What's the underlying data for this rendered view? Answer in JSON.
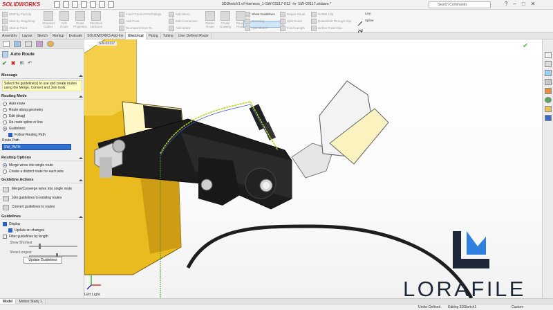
{
  "window": {
    "app_name": "SOLIDWORKS",
    "title": "3DSketch1 of Harness_1-SW-03117-012 -in- SW-03117.sldasm *",
    "search_placeholder": "Search Commands",
    "controls": [
      "?",
      "–",
      "□",
      "✕"
    ]
  },
  "command_manager": {
    "group1": [
      "Start by Pin/Clip",
      "Start by Drag/Drop",
      "Start at Point"
    ],
    "group2": [
      "Standard Cables",
      "Edit Route",
      "Route Properties",
      "Electrical Attributes"
    ],
    "group3": [
      "Insert Connectors/Fittings",
      "Add Point",
      "Re-import From-To"
    ],
    "group4": [
      "Edit Wires",
      "Edit Connection",
      "Add Splice"
    ],
    "group5": [
      "Flatten Route",
      "Create Drawing",
      "Reuse Route"
    ],
    "group6": [
      "Show Guidelines",
      "Covering",
      "Add Sketch"
    ],
    "group7": [
      "Repair Route",
      "Split Route",
      "Fixed Length"
    ],
    "group8": [
      "Rotate Clip",
      "Route/Edit Through Clip",
      "Unfree Fixed Clip"
    ],
    "group9": [
      "Line",
      "Spline"
    ]
  },
  "tabs": [
    "Assembly",
    "Layout",
    "Sketch",
    "Markup",
    "Evaluate",
    "SOLIDWORKS Add-Ins",
    "Electrical",
    "Piping",
    "Tubing",
    "User Defined Route"
  ],
  "active_tab": "Electrical",
  "panel": {
    "title": "Auto Route",
    "message": {
      "header": "Message",
      "text": "Select the guideline(s) to use and create routes using the Merge, Convert and Join tools."
    },
    "routing_mode": {
      "header": "Routing Mode",
      "options": [
        "Auto-route",
        "Route along geometry",
        "Edit (drag)",
        "Re-route spline or line",
        "Guidelines"
      ],
      "selected": "Guidelines",
      "follow_path_label": "Follow Routing Path"
    },
    "route_path": {
      "header": "Route Path",
      "value": "SW_PATH"
    },
    "routing_options": {
      "header": "Routing Options",
      "options": [
        "Merge wires into single route",
        "Create a distinct route for each wire"
      ],
      "selected": "Merge wires into single route"
    },
    "guideline_actions": {
      "header": "Guideline Actions",
      "items": [
        "Merge/Converge wires into single route",
        "Join guidelines to existing routes",
        "Convert guidelines to routes"
      ]
    },
    "guidelines": {
      "header": "Guidelines",
      "display_label": "Display",
      "update_label": "Update on changes",
      "filter_label": "Filter guidelines by length",
      "show_shortest": "Show Shortest",
      "show_longest": "Show Longest",
      "shortest_level": 0.2,
      "longest_level": 0.55,
      "update_button": "Update Guidelines"
    }
  },
  "viewport": {
    "part_label": "SW-03117",
    "corner_label": "Left Light"
  },
  "bottom_tabs": [
    "Model",
    "Motion Study 1"
  ],
  "status": {
    "under_defined": "Under Defined",
    "editing": "Editing 3DSketch1",
    "units": "Custom"
  },
  "watermark": {
    "text": "LORAFILE"
  },
  "colors": {
    "accent": "#2a62c9",
    "brand": "#d2232a",
    "watermark": "#1d2738",
    "part_yellow": "#f3c624"
  }
}
